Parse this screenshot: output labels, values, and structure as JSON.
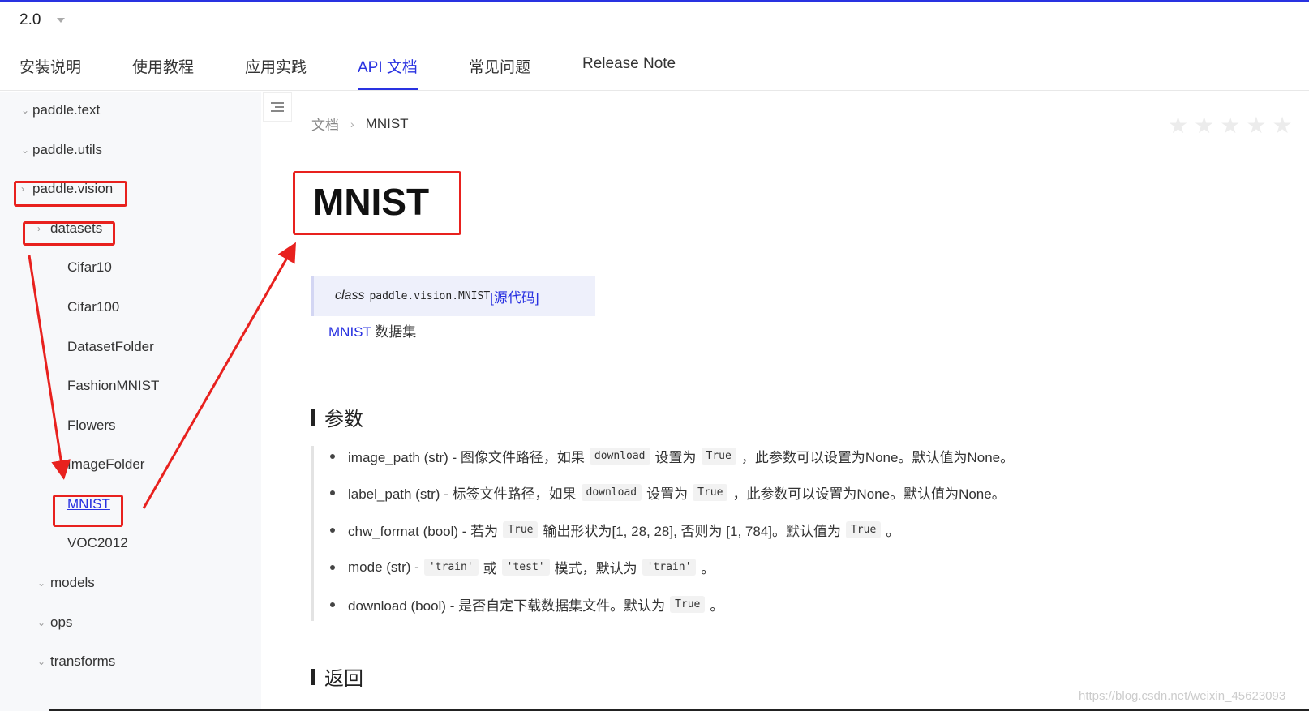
{
  "version": {
    "label": "2.0"
  },
  "nav": {
    "tabs": [
      {
        "label": "安装说明",
        "active": false
      },
      {
        "label": "使用教程",
        "active": false
      },
      {
        "label": "应用实践",
        "active": false
      },
      {
        "label": "API 文档",
        "active": true
      },
      {
        "label": "常见问题",
        "active": false
      },
      {
        "label": "Release Note",
        "active": false
      }
    ]
  },
  "sidebar": {
    "items": [
      {
        "label": "paddle.text",
        "expanded": true
      },
      {
        "label": "paddle.utils",
        "expanded": true
      },
      {
        "label": "paddle.vision",
        "expanded": false
      },
      {
        "label": "datasets",
        "expanded": false
      },
      {
        "label": "Cifar10"
      },
      {
        "label": "Cifar100"
      },
      {
        "label": "DatasetFolder"
      },
      {
        "label": "FashionMNIST"
      },
      {
        "label": "Flowers"
      },
      {
        "label": "ImageFolder"
      },
      {
        "label": "MNIST",
        "active": true
      },
      {
        "label": "VOC2012"
      },
      {
        "label": "models",
        "expanded": true
      },
      {
        "label": "ops",
        "expanded": true
      },
      {
        "label": "transforms",
        "expanded": true
      }
    ]
  },
  "breadcrumb": {
    "root": "文档",
    "current": "MNIST"
  },
  "rating": {
    "stars": 5,
    "filled": 0
  },
  "page": {
    "title": "MNIST",
    "class_keyword": "class",
    "class_path": "paddle.vision.MNIST",
    "source_link": "[源代码]",
    "desc_link": "MNIST",
    "desc_rest": " 数据集"
  },
  "sections": {
    "params_heading": "参数",
    "returns_heading": "返回"
  },
  "params": [
    {
      "parts": [
        "image_path (str) - 图像文件路径，如果",
        "download",
        "设置为",
        "True",
        "，此参数可以设置为None。默认值为None。"
      ]
    },
    {
      "parts": [
        "label_path (str) - 标签文件路径，如果",
        "download",
        "设置为",
        "True",
        "，此参数可以设置为None。默认值为None。"
      ]
    },
    {
      "parts": [
        "chw_format (bool) - 若为",
        "True",
        "输出形状为[1, 28, 28], 否则为 [1, 784]。默认值为",
        "True",
        "。"
      ]
    },
    {
      "parts": [
        "mode (str) -",
        "'train'",
        "或",
        "'test'",
        "模式，默认为",
        "'train'",
        "。"
      ]
    },
    {
      "parts": [
        "download (bool) - 是否自定下载数据集文件。默认为",
        "True",
        "。"
      ]
    }
  ],
  "watermark": "https://blog.csdn.net/weixin_45623093",
  "colors": {
    "accent": "#2932e1",
    "annotation": "#e8211e"
  }
}
